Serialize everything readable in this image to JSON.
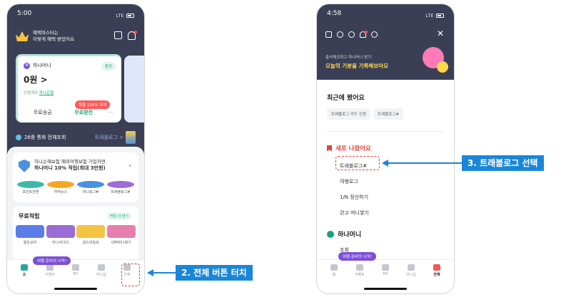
{
  "phone1": {
    "time": "5:00",
    "signal": "LTE",
    "benefit_text_line1": "혜택마스터는",
    "benefit_text_line2": "이렇게 혜택 받았어요",
    "money_card": {
      "title": "하나머니",
      "charge_label": "충전",
      "amount": "0원 >",
      "linked_prefix": "연결계좌",
      "linked_bank": "하나은행",
      "exchange_badge": "환율 100% 우대",
      "btn_send": "무료송금",
      "btn_exchange": "무료환전",
      "btn_more": "···"
    },
    "currency_text": "26종 통화 전체조회",
    "travel_link": "트래블로그 >",
    "insurance_line1": "하나손해보험 해외여행보험 가입하면",
    "insurance_line2": "하나머니 10% 적립(최대 3만원)",
    "quick_items": [
      "포인트전환",
      "하작뉴스",
      "머니로그#",
      "트래블로그#"
    ],
    "free_title": "무료적립",
    "free_more": "적립 더 받기",
    "free_items": [
      "행운상자",
      "머니사다리",
      "골드바응모",
      "대박머니쌓기"
    ],
    "trip_pill": "여행 준비의 시작!",
    "tabs": [
      "홈",
      "이벤트",
      "MY",
      "머니샵",
      "전체"
    ]
  },
  "phone2": {
    "time": "4:58",
    "signal": "LTE",
    "banner_small": "출석체크하고 하나머니 받기",
    "banner_big": "오늘의 기분을 기록해보아요",
    "recent_title": "최근에 봤어요",
    "recent_chips": [
      "트래블로그 카드 신청",
      "트래블로그#"
    ],
    "new_title": "새로 나왔어요",
    "new_items": [
      "트래블로그#",
      "여행로그",
      "1/N 정산하기",
      "걷고 머니쌓기"
    ],
    "hana_section": "하나머니",
    "hana_sub": "조회",
    "trip_pill": "여행 준비의 시작!",
    "tabs": [
      "홈",
      "이벤트",
      "MY",
      "머니샵",
      "전체"
    ]
  },
  "callouts": {
    "step2": "2. 전체 버튼 터치",
    "step3": "3. 트래블로그 선택"
  },
  "colors": {
    "header_dark": "#3b3f55",
    "accent_green": "#1aa37a",
    "callout_blue": "#1a86d8",
    "highlight_red": "#e53935"
  }
}
